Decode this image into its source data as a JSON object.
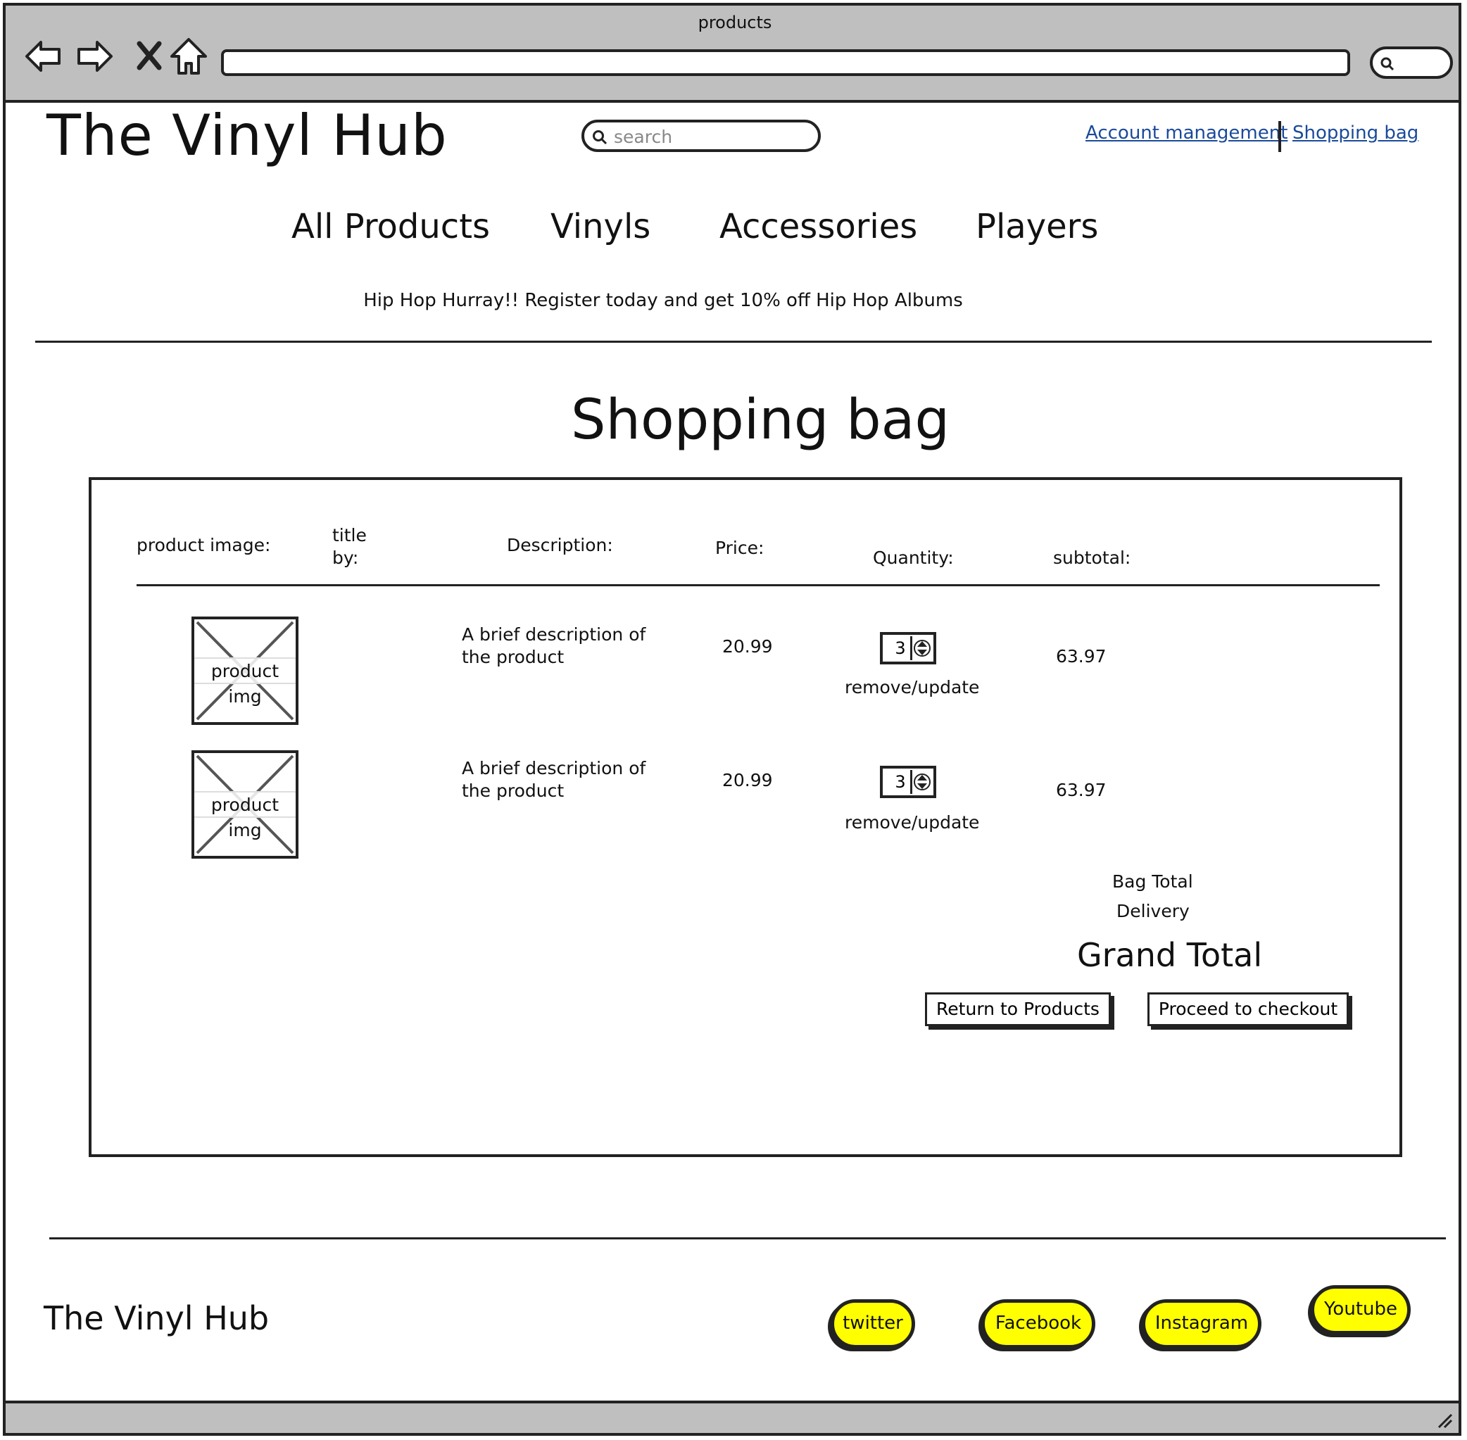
{
  "window": {
    "title": "products"
  },
  "header": {
    "logo": "The Vinyl Hub",
    "search_placeholder": "search",
    "links": {
      "account": "Account management",
      "bag": "Shopping bag"
    }
  },
  "nav": {
    "items": [
      "All Products",
      "Vinyls",
      "Accessories",
      "Players"
    ]
  },
  "promo": "Hip Hop Hurray!! Register today and get 10% off Hip Hop Albums",
  "bag": {
    "title": "Shopping bag",
    "columns": {
      "image": "product image:",
      "title_line1": "title",
      "title_line2": "by:",
      "description": "Description:",
      "price": "Price:",
      "quantity": "Quantity:",
      "subtotal": "subtotal:"
    },
    "rows": [
      {
        "image_label": "product img",
        "description": "A brief description of the product",
        "price": "20.99",
        "quantity": "3",
        "action": "remove/update",
        "subtotal": "63.97"
      },
      {
        "image_label": "product img",
        "description": "A brief description of the product",
        "price": "20.99",
        "quantity": "3",
        "action": "remove/update",
        "subtotal": "63.97"
      }
    ],
    "totals": {
      "bag_total": "Bag Total",
      "delivery": "Delivery",
      "grand_total": "Grand Total"
    },
    "buttons": {
      "return": "Return to Products",
      "checkout": "Proceed to checkout"
    }
  },
  "footer": {
    "logo": "The Vinyl Hub",
    "social": [
      "twitter",
      "Facebook",
      "Instagram",
      "Youtube"
    ],
    "social_color": "#ffff00"
  }
}
